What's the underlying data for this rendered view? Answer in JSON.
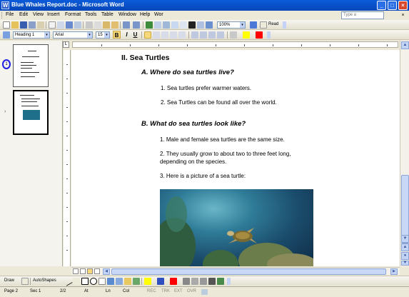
{
  "window": {
    "title": "Blue Whales Report.doc - Microsoft Word"
  },
  "menu": {
    "items": [
      "File",
      "Edit",
      "View",
      "Insert",
      "Format",
      "Tools",
      "Table",
      "Window",
      "Help",
      "Wor"
    ],
    "ask_placeholder": "Type a"
  },
  "toolbar": {
    "zoom": "100%",
    "read_label": "Read",
    "style_value": "Heading 1",
    "font_value": "Arial",
    "size_value": "15",
    "bold": "B",
    "italic": "I",
    "underline": "U"
  },
  "document": {
    "heading": "II. Sea Turtles",
    "section_a": "A.  Where do sea turtles live?",
    "a_items": [
      "1.   Sea turtles prefer warmer waters.",
      "2.   Sea Turtles can be found all over the world."
    ],
    "section_b": "B.   What do sea turtles look like?",
    "b_items": [
      "1.    Male and female sea turtles are the same size.",
      "2.  They usually grow to about two to three feet long,",
      "depending on the species.",
      "3.  Here is a picture of a sea turtle:"
    ]
  },
  "drawing_toolbar": {
    "draw_label": "Draw",
    "autoshapes_label": "AutoShapes"
  },
  "statusbar": {
    "page": "Page 2",
    "section": "Sec 1",
    "page_of": "2/2",
    "at": "At",
    "ln": "Ln",
    "col": "Col",
    "rec": "REC",
    "trk": "TRK",
    "ext": "EXT",
    "ovr": "OVR"
  },
  "colors": {
    "titlebar": "#0a5bd9",
    "highlight": "#ffff00",
    "font_color": "#ff0000",
    "page_marker": "#2020e0"
  }
}
